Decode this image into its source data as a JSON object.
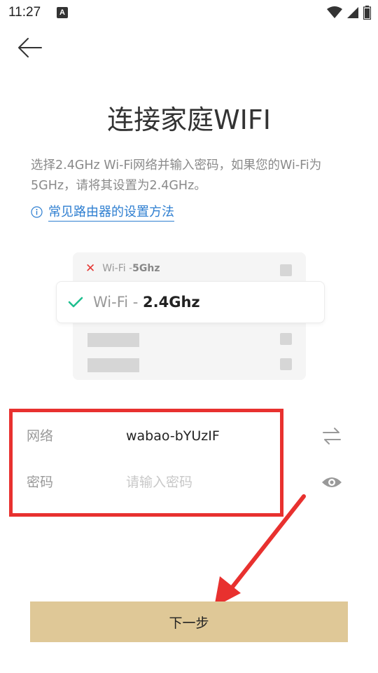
{
  "status_bar": {
    "time": "11:27",
    "notification_icon": "A"
  },
  "header": {
    "back_icon": "arrow-left-icon"
  },
  "page": {
    "title": "连接家庭WIFI",
    "description": "选择2.4GHz Wi-Fi网络并输入密码，如果您的Wi-Fi为5GHz，请将其设置为2.4GHz。",
    "help_link": "常见路由器的设置方法"
  },
  "illustration": {
    "wifi_5g_prefix": "Wi-Fi - ",
    "wifi_5g_band": "5Ghz",
    "wifi_24g_prefix": "Wi-Fi - ",
    "wifi_24g_band": "2.4Ghz"
  },
  "form": {
    "network_label": "网络",
    "network_value": "wabao-bYUzIF",
    "password_label": "密码",
    "password_placeholder": "请输入密码",
    "password_value": ""
  },
  "actions": {
    "next_label": "下一步"
  },
  "colors": {
    "accent_link": "#2f7fd1",
    "button_bg": "#dfc897",
    "annotation_red": "#e8312f",
    "check_green": "#1fbf8f"
  }
}
